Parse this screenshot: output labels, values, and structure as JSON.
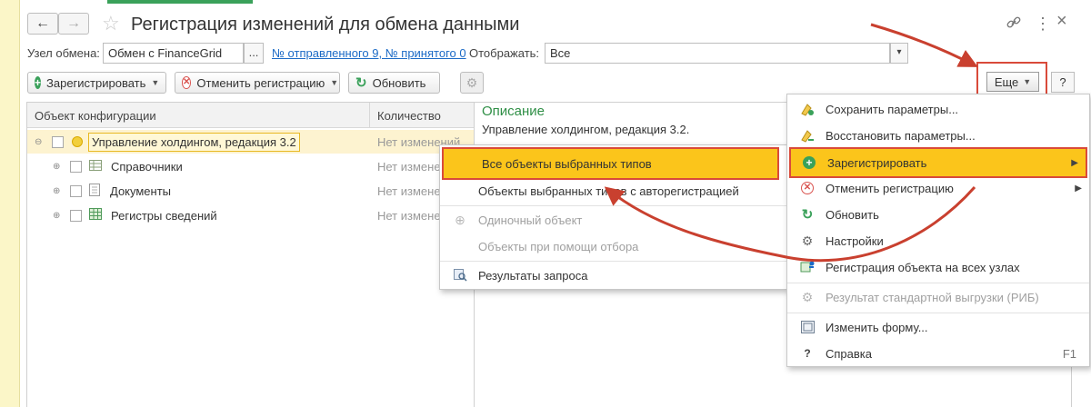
{
  "window": {
    "title": "Регистрация изменений для обмена данными",
    "back_icon": "←",
    "forward_icon": "→",
    "star_icon": "☆",
    "link_icon": "🔗",
    "more_icon": "⋮",
    "close_icon": "×"
  },
  "filters": {
    "node_label": "Узел обмена:",
    "node_value": "Обмен с FinanceGrid",
    "node_select_btn": "...",
    "sent_received_link": "№ отправленного 9, № принятого 0",
    "display_label": "Отображать:",
    "display_value": "Все",
    "display_dropdown": "▾"
  },
  "toolbar": {
    "register_label": "Зарегистрировать",
    "cancel_reg_label": "Отменить регистрацию",
    "refresh_label": "Обновить",
    "more_label": "Еще",
    "help_label": "?"
  },
  "table": {
    "col_object": "Объект конфигурации",
    "col_count": "Количество",
    "rows": [
      {
        "expander": "⊖",
        "name": "Управление холдингом, редакция 3.2",
        "count": "Нет изменений",
        "icon": "circle-yellow-icon"
      },
      {
        "expander": "⊕",
        "name": "Справочники",
        "count": "Нет изменен",
        "icon": "catalog-icon"
      },
      {
        "expander": "⊕",
        "name": "Документы",
        "count": "Нет изменен",
        "icon": "document-icon"
      },
      {
        "expander": "⊕",
        "name": "Регистры сведений",
        "count": "Нет изменен",
        "icon": "register-icon"
      }
    ]
  },
  "description": {
    "heading": "Описание",
    "text": "Управление холдингом, редакция 3.2."
  },
  "submenu": {
    "items": [
      {
        "label": "Все объекты выбранных типов",
        "highlighted": true,
        "disabled": false
      },
      {
        "label": "Объекты выбранных типов с авторегистрацией",
        "highlighted": false,
        "disabled": false
      },
      {
        "label": "Одиночный объект",
        "highlighted": false,
        "disabled": true
      },
      {
        "label": "Объекты при помощи отбора",
        "highlighted": false,
        "disabled": true
      },
      {
        "label": "Результаты запроса",
        "highlighted": false,
        "disabled": false
      }
    ]
  },
  "more_menu": {
    "items": [
      {
        "label": "Сохранить параметры...",
        "icon": "save-params-icon"
      },
      {
        "label": "Восстановить параметры...",
        "icon": "restore-params-icon"
      },
      {
        "label": "Зарегистрировать",
        "icon": "plus-circle-icon",
        "highlighted": true,
        "submenu": true
      },
      {
        "label": "Отменить регистрацию",
        "icon": "cross-circle-icon",
        "submenu": true
      },
      {
        "label": "Обновить",
        "icon": "refresh-icon"
      },
      {
        "label": "Настройки",
        "icon": "settings-icon"
      },
      {
        "label": "Регистрация объекта на всех узлах",
        "icon": "register-all-nodes-icon"
      },
      {
        "label": "Результат стандартной выгрузки (РИБ)",
        "icon": "gear-disabled-icon",
        "disabled": true
      },
      {
        "label": "Изменить форму...",
        "icon": "form-edit-icon"
      },
      {
        "label": "Справка",
        "icon": "help-icon",
        "shortcut": "F1"
      }
    ]
  },
  "colors": {
    "accent_yellow": "#fbc51b",
    "annotation_red": "#d94a3a",
    "link_blue": "#1b6ac6",
    "green": "#3aa15a"
  }
}
